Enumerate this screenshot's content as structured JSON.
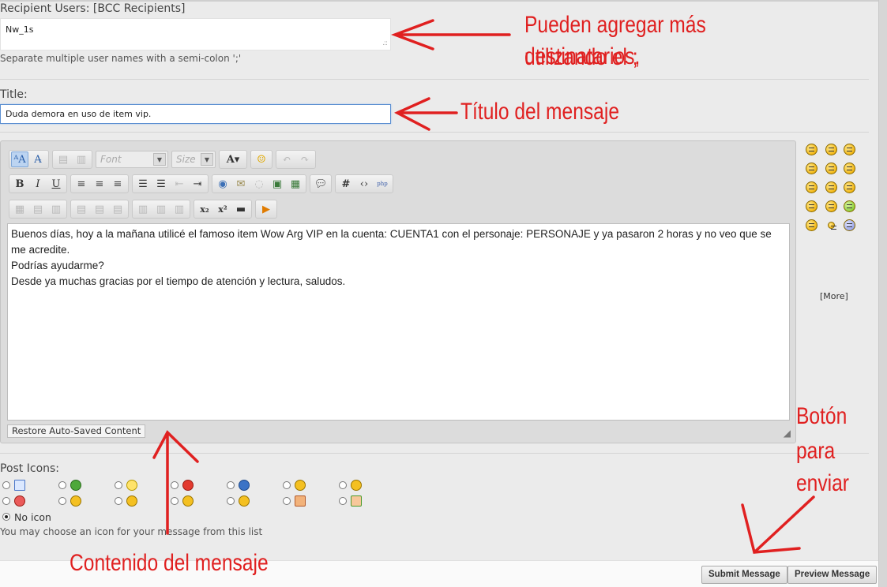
{
  "recipients": {
    "label": "Recipient Users: [BCC Recipients]",
    "value": "Nw_1s",
    "hint": "Separate multiple user names with a semi-colon ';'"
  },
  "title_field": {
    "label": "Title:",
    "value": "Duda demora en uso de item vip."
  },
  "editor": {
    "toolbar": {
      "font_placeholder": "Font",
      "size_placeholder": "Size"
    },
    "content": {
      "line1": "Buenos días, hoy a la mañana utilicé el famoso item Wow Arg VIP en la cuenta: CUENTA1 con el personaje: PERSONAJE y ya pasaron 2 horas y no veo que se me acredite.",
      "line2": "Podrías ayudarme?",
      "line3": "Desde ya muchas gracias por el tiempo de atención y lectura, saludos."
    },
    "restore_label": "Restore Auto-Saved Content"
  },
  "smilies": {
    "more_label": "[More]"
  },
  "post_icons": {
    "label": "Post Icons:",
    "no_icon_label": "No icon",
    "hint": "You may choose an icon for your message from this list"
  },
  "buttons": {
    "submit": "Submit Message",
    "preview": "Preview Message"
  },
  "annotations": {
    "recipients_note_1": "Pueden agregar más destinatarios,",
    "recipients_note_2": "utilizando el ;",
    "title_note": "Título del mensaje",
    "content_note": "Contenido del mensaje",
    "submit_note_1": "Botón",
    "submit_note_2": "para",
    "submit_note_3": "enviar"
  },
  "colors": {
    "annotation": "#e02020",
    "focus_border": "#5b8fd1"
  }
}
